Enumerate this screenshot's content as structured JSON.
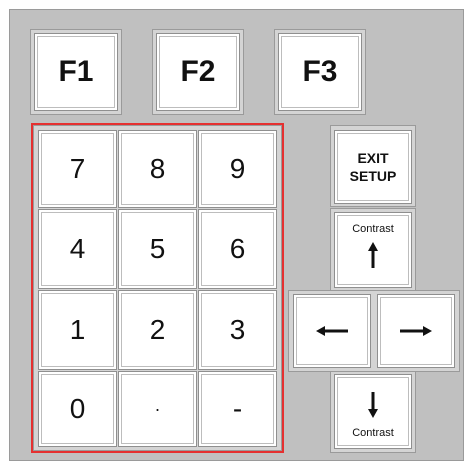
{
  "function_keys": [
    "F1",
    "F2",
    "F3"
  ],
  "keypad_rows": [
    [
      "7",
      "8",
      "9"
    ],
    [
      "4",
      "5",
      "6"
    ],
    [
      "1",
      "2",
      "3"
    ],
    [
      "0",
      "·",
      "-"
    ]
  ],
  "side_keys": {
    "exit_setup_line1": "EXIT",
    "exit_setup_line2": "SETUP",
    "contrast_up_label": "Contrast",
    "contrast_down_label": "Contrast"
  },
  "icons": {
    "up": "arrow-up-icon",
    "down": "arrow-down-icon",
    "left": "arrow-left-icon",
    "right": "arrow-right-icon"
  },
  "colors": {
    "panel": "#c0c0c0",
    "key": "#ffffff",
    "highlight_border": "#e53030"
  }
}
